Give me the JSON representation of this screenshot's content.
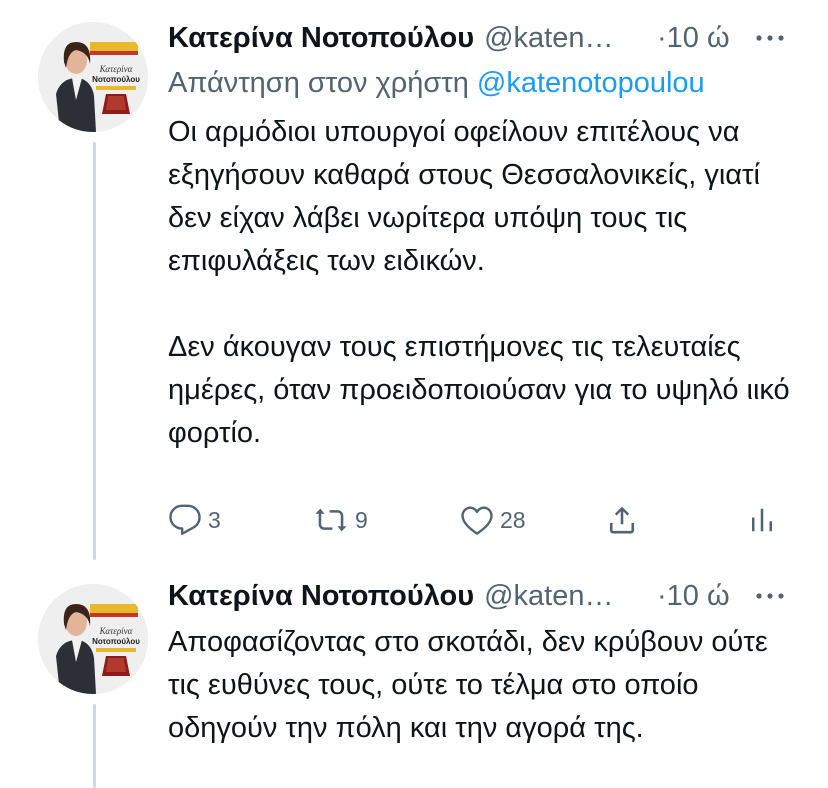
{
  "tweets": [
    {
      "author_name": "Κατερίνα Νοτοπούλου",
      "author_handle": "@katen…",
      "time": "·10 ώ",
      "replying_prefix": "Απάντηση στον χρήστη",
      "replying_handle": "@katenotopoulou",
      "paragraphs": [
        "Οι αρμόδιοι υπουργοί οφείλουν επιτέλους να εξηγήσουν καθαρά στους Θεσσαλονικείς, γιατί δεν είχαν λάβει νωρίτερα υπόψη τους τις επιφυλάξεις των ειδικών.",
        "Δεν άκουγαν τους επιστήμονες τις τελευταίες ημέρες, όταν προειδοποιούσαν για το υψηλό ιικό φορτίο."
      ],
      "replies": "3",
      "retweets": "9",
      "likes": "28",
      "avatar_text": "Κατερίνα Νοτοπούλου"
    },
    {
      "author_name": "Κατερίνα Νοτοπούλου",
      "author_handle": "@katen…",
      "time": "·10 ώ",
      "paragraphs": [
        "Αποφασίζοντας στο σκοτάδι, δεν κρύβουν ούτε τις ευθύνες τους, ούτε το τέλμα στο οποίο οδηγούν την πόλη και την αγορά της."
      ],
      "avatar_text": "Κατερίνα Νοτοπούλου"
    }
  ],
  "colors": {
    "text": "#0f1419",
    "secondary": "#536471",
    "link": "#1d9bf0",
    "thread_line": "#cfd9de"
  },
  "icons": [
    "reply-icon",
    "retweet-icon",
    "like-icon",
    "share-icon",
    "analytics-icon",
    "more-icon"
  ]
}
